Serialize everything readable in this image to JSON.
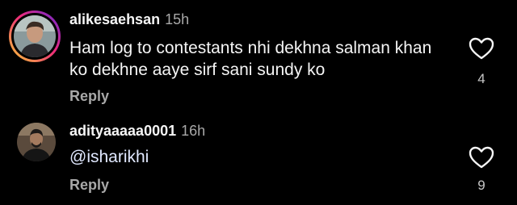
{
  "comments": [
    {
      "username": "alikesaehsan",
      "time": "15h",
      "text": "Ham log to contestants nhi dekhna salman khan ko dekhne aaye sirf sani  sundy ko",
      "reply_label": "Reply",
      "like_count": "4",
      "has_story_ring": true
    },
    {
      "username": "adityaaaaa0001",
      "time": "16h",
      "mention": "@isharikhi",
      "reply_label": "Reply",
      "like_count": "9",
      "has_story_ring": false
    }
  ],
  "colors": {
    "background": "#000000",
    "text_primary": "#f5f5f5",
    "text_secondary": "#a8a8a8",
    "mention": "#e0e8ff"
  },
  "icons": {
    "like": "heart-outline-icon"
  }
}
